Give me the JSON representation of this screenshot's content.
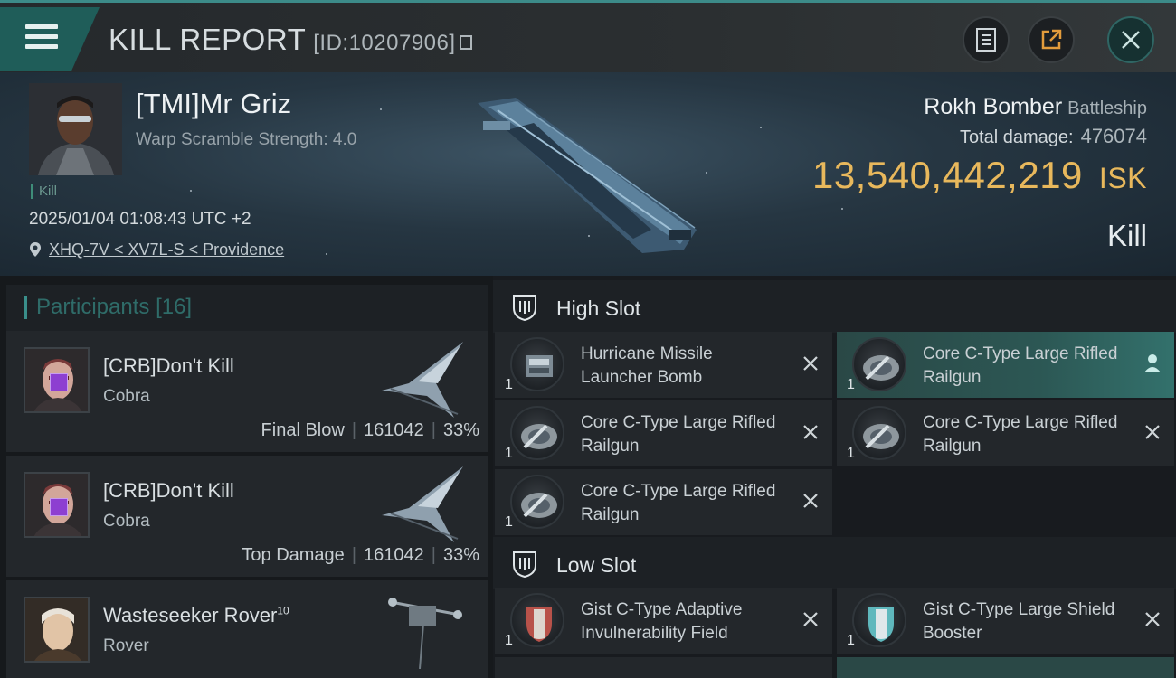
{
  "header": {
    "title": "KILL REPORT",
    "report_id": "[ID:10207906]"
  },
  "victim": {
    "name": "[TMI]Mr Griz",
    "warp_scramble": "Warp Scramble Strength: 4.0",
    "tag": "Kill",
    "datetime": "2025/01/04 01:08:43 UTC +2",
    "location": "XHQ-7V < XV7L-S < Providence",
    "ship": "Rokh Bomber",
    "ship_class": "Battleship",
    "total_damage_label": "Total damage:",
    "total_damage": "476074",
    "isk_value": "13,540,442,219",
    "isk_unit": "ISK",
    "result": "Kill"
  },
  "participants": {
    "label": "Participants",
    "count": "[16]",
    "rows": [
      {
        "name": "[CRB]Don't Kill",
        "ship": "Cobra",
        "role": "Final Blow",
        "damage": "161042",
        "percent": "33%"
      },
      {
        "name": "[CRB]Don't Kill",
        "ship": "Cobra",
        "role": "Top Damage",
        "damage": "161042",
        "percent": "33%"
      },
      {
        "name": "Wasteseeker Rover",
        "name_sup": "10",
        "ship": "Rover"
      }
    ]
  },
  "slots": {
    "high": {
      "label": "High Slot",
      "modules": [
        {
          "name": "Hurricane Missile Launcher Bomb",
          "qty": "1",
          "icon": "launcher-icon"
        },
        {
          "name": "Core C-Type Large Rifled Railgun",
          "qty": "1",
          "icon": "railgun-icon"
        },
        {
          "name": "Core C-Type Large Rifled Railgun",
          "qty": "1",
          "icon": "railgun-icon"
        },
        {
          "name": "Core C-Type Large Rifled Railgun",
          "qty": "1",
          "icon": "railgun-icon"
        },
        {
          "name": "Core C-Type Large Rifled Railgun",
          "qty": "1",
          "icon": "railgun-icon"
        }
      ]
    },
    "low": {
      "label": "Low Slot",
      "modules": [
        {
          "name": "Gist C-Type Adaptive Invulnerability Field",
          "qty": "1",
          "icon": "shield-field-icon"
        },
        {
          "name": "Gist C-Type Large Shield Booster",
          "qty": "1",
          "icon": "shield-booster-icon"
        }
      ]
    }
  },
  "colors": {
    "accent": "#3c8b89",
    "isk": "#e8b85c",
    "highlight": "#2c5754"
  }
}
